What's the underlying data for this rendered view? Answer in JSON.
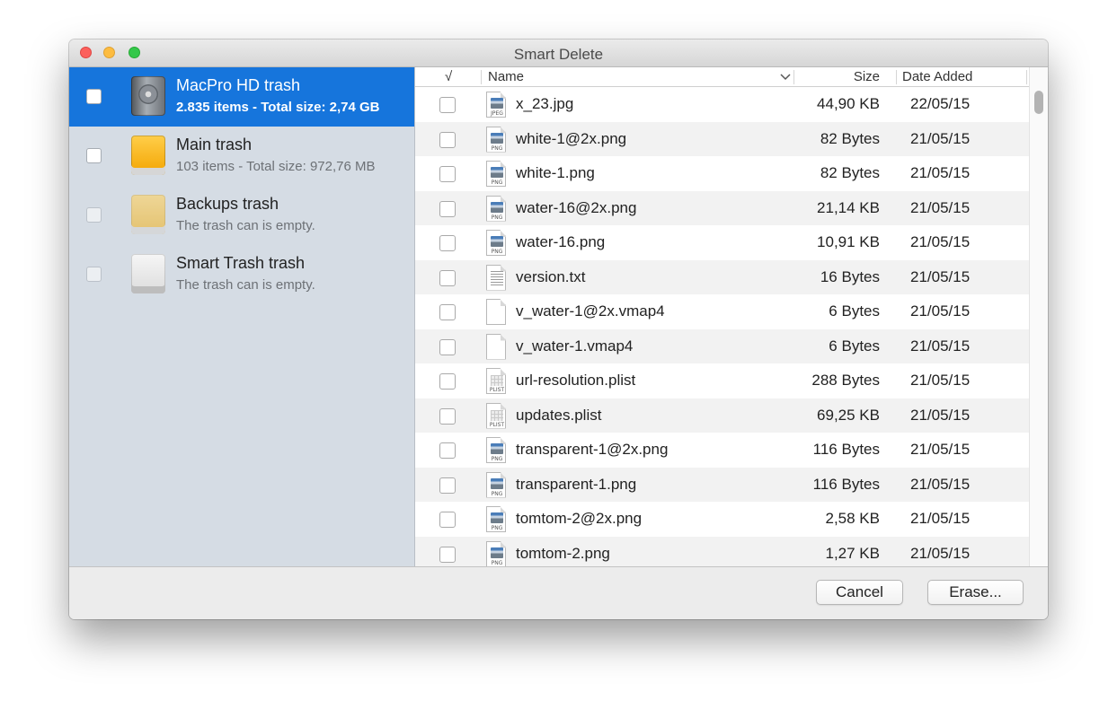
{
  "window": {
    "title": "Smart Delete"
  },
  "sidebar": {
    "items": [
      {
        "name": "MacPro HD trash",
        "subtitle": "2.835 items - Total size: 2,74 GB",
        "icon": "hard-drive-icon",
        "selected": true
      },
      {
        "name": "Main trash",
        "subtitle": "103 items - Total size: 972,76 MB",
        "icon": "orange-drive-icon"
      },
      {
        "name": "Backups trash",
        "subtitle": "The trash can is empty.",
        "icon": "yellow-drive-icon"
      },
      {
        "name": "Smart Trash trash",
        "subtitle": "The trash can is empty.",
        "icon": "white-drive-icon"
      }
    ]
  },
  "table": {
    "headers": {
      "check": "√",
      "name": "Name",
      "size": "Size",
      "date": "Date Added"
    },
    "sort_indicator": "chevron-down-icon",
    "rows": [
      {
        "name": "x_23.jpg",
        "size": "44,90 KB",
        "date": "22/05/15",
        "icon": "jpeg-file-icon",
        "icon_label": "JPEG"
      },
      {
        "name": "white-1@2x.png",
        "size": "82 Bytes",
        "date": "21/05/15",
        "icon": "png-file-icon",
        "icon_label": "PNG"
      },
      {
        "name": "white-1.png",
        "size": "82 Bytes",
        "date": "21/05/15",
        "icon": "png-file-icon",
        "icon_label": "PNG"
      },
      {
        "name": "water-16@2x.png",
        "size": "21,14 KB",
        "date": "21/05/15",
        "icon": "png-file-icon",
        "icon_label": "PNG"
      },
      {
        "name": "water-16.png",
        "size": "10,91 KB",
        "date": "21/05/15",
        "icon": "png-file-icon",
        "icon_label": "PNG"
      },
      {
        "name": "version.txt",
        "size": "16 Bytes",
        "date": "21/05/15",
        "icon": "text-file-icon",
        "icon_label": ""
      },
      {
        "name": "v_water-1@2x.vmap4",
        "size": "6 Bytes",
        "date": "21/05/15",
        "icon": "blank-file-icon",
        "icon_label": ""
      },
      {
        "name": "v_water-1.vmap4",
        "size": "6 Bytes",
        "date": "21/05/15",
        "icon": "blank-file-icon",
        "icon_label": ""
      },
      {
        "name": "url-resolution.plist",
        "size": "288 Bytes",
        "date": "21/05/15",
        "icon": "plist-file-icon",
        "icon_label": "PLIST"
      },
      {
        "name": "updates.plist",
        "size": "69,25 KB",
        "date": "21/05/15",
        "icon": "plist-file-icon",
        "icon_label": "PLIST"
      },
      {
        "name": "transparent-1@2x.png",
        "size": "116 Bytes",
        "date": "21/05/15",
        "icon": "png-file-icon",
        "icon_label": "PNG"
      },
      {
        "name": "transparent-1.png",
        "size": "116 Bytes",
        "date": "21/05/15",
        "icon": "png-file-icon",
        "icon_label": "PNG"
      },
      {
        "name": "tomtom-2@2x.png",
        "size": "2,58 KB",
        "date": "21/05/15",
        "icon": "png-file-icon",
        "icon_label": "PNG"
      },
      {
        "name": "tomtom-2.png",
        "size": "1,27 KB",
        "date": "21/05/15",
        "icon": "png-file-icon",
        "icon_label": "PNG"
      }
    ]
  },
  "footer": {
    "cancel_label": "Cancel",
    "erase_label": "Erase..."
  },
  "colors": {
    "selection": "#1675dc",
    "sidebar_bg": "#d5dce4",
    "row_alt": "#f2f2f2"
  }
}
